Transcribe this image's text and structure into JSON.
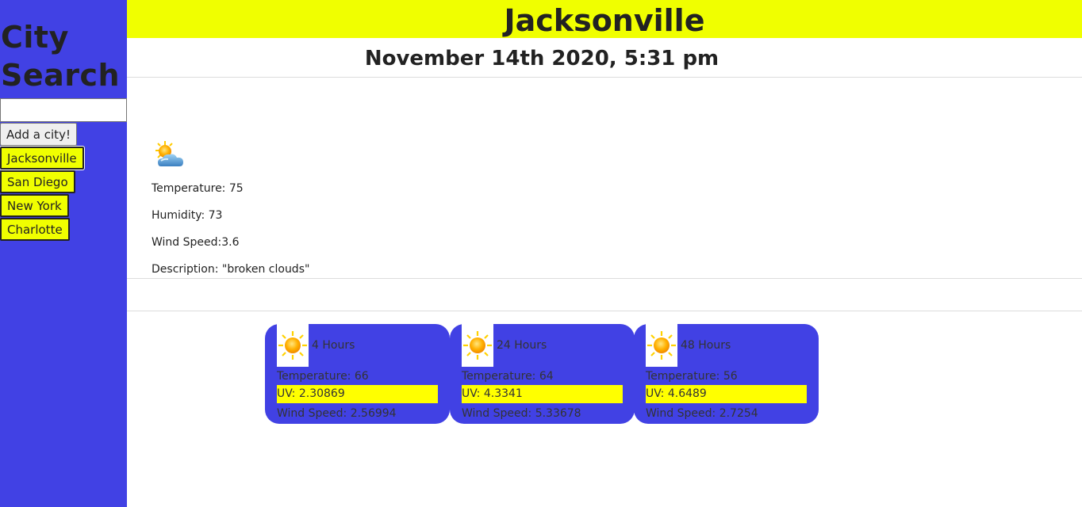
{
  "sidebar": {
    "title": "City Search",
    "input_value": "",
    "add_button": "Add a city!",
    "cities": [
      "Jacksonville",
      "San Diego",
      "New York",
      "Charlotte"
    ]
  },
  "header": {
    "city": "Jacksonville"
  },
  "date": "November 14th 2020, 5:31 pm",
  "current": {
    "icon": "partly-cloudy-icon",
    "temperature": "Temperature: 75",
    "humidity": "Humidity: 73",
    "wind": "Wind Speed:3.6",
    "description": "Description: \"broken clouds\""
  },
  "forecast": [
    {
      "icon": "sun-icon",
      "hours": "4 Hours",
      "temperature": "Temperature: 66",
      "uv": "UV: 2.30869",
      "wind": "Wind Speed: 2.56994"
    },
    {
      "icon": "sun-icon",
      "hours": "24 Hours",
      "temperature": "Temperature: 64",
      "uv": "UV: 4.3341",
      "wind": "Wind Speed: 5.33678"
    },
    {
      "icon": "sun-icon",
      "hours": "48 Hours",
      "temperature": "Temperature: 56",
      "uv": "UV: 4.6489",
      "wind": "Wind Speed: 2.7254"
    }
  ],
  "colors": {
    "sidebar": "#4141e4",
    "accent": "#f0ff00",
    "uv": "#ffff00"
  }
}
